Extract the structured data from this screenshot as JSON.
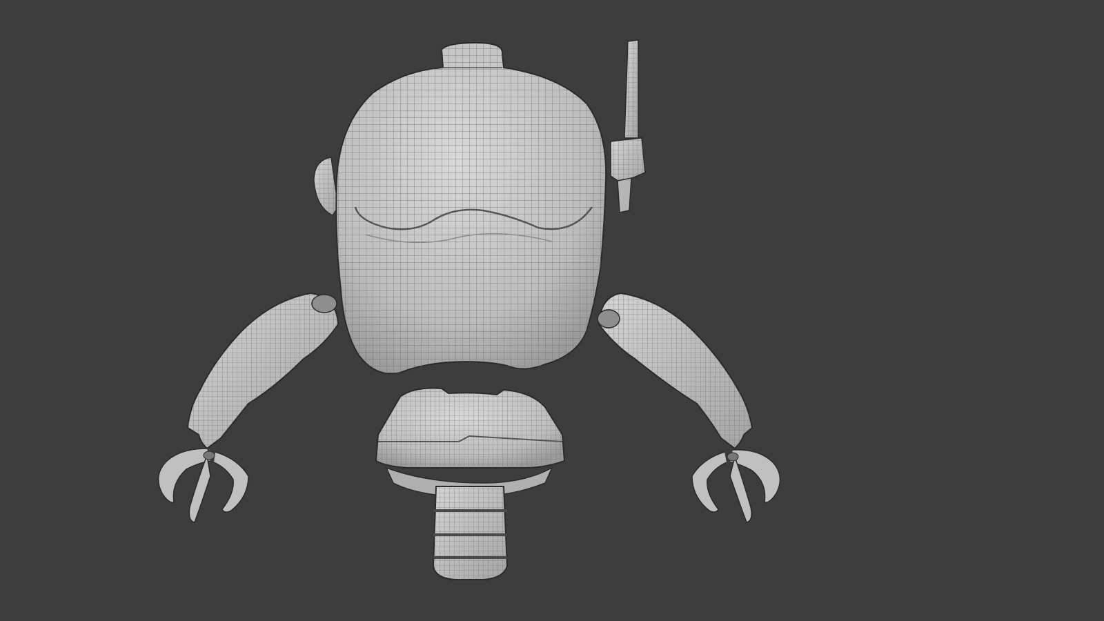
{
  "viewport": {
    "background": "#3d3d3d",
    "mode": "wireframe-overlay",
    "model_parts": [
      "robot-head",
      "antenna",
      "left-ear",
      "left-arm",
      "right-arm",
      "torso",
      "waist"
    ]
  },
  "colors": {
    "mesh_fill": "#c9c9c9",
    "mesh_shade": "#a8a8a8",
    "wire": "#6a6a6a",
    "outline": "#2a2a2a"
  }
}
